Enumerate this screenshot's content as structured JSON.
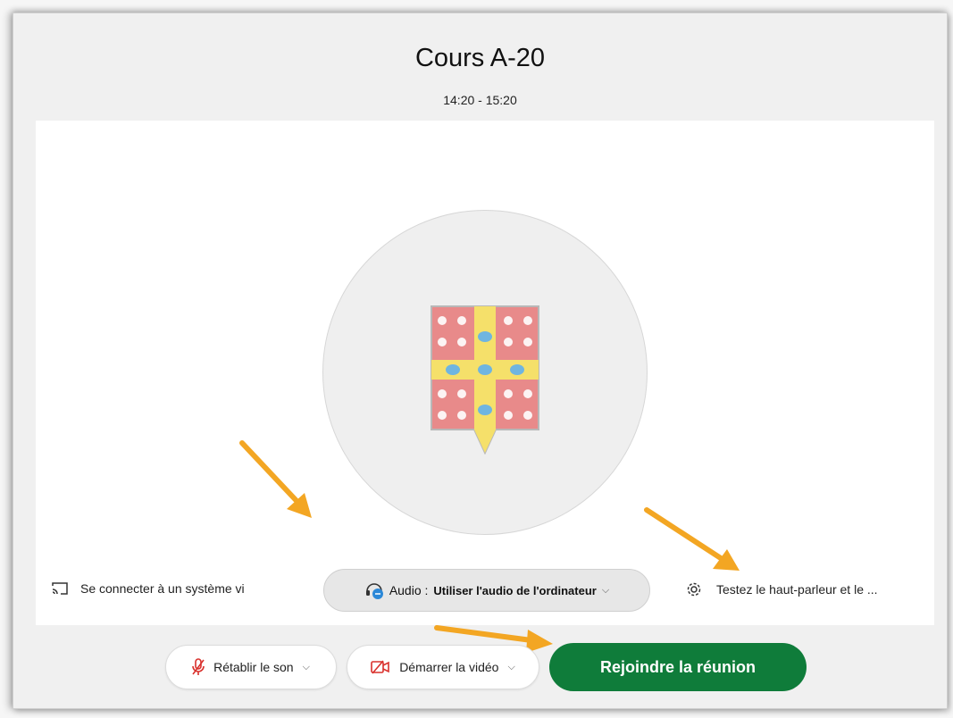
{
  "meeting": {
    "title": "Cours A-20",
    "time": "14:20 - 15:20"
  },
  "bottom_bar": {
    "connect_label": "Se connecter à un système vi",
    "audio_prefix": "Audio : ",
    "audio_value": "Utiliser l'audio de l'ordinateur",
    "test_label": "Testez le haut-parleur et le ..."
  },
  "controls": {
    "unmute_label": "Rétablir le son",
    "video_label": "Démarrer la vidéo",
    "join_label": "Rejoindre la réunion"
  },
  "icons": [
    "cast-icon",
    "headset-icon",
    "gear-icon",
    "mic-muted-icon",
    "video-off-icon",
    "chevron-down-icon",
    "crest-avatar",
    "annotation-arrow"
  ],
  "colors": {
    "join_button": "#0f7c3a",
    "arrow": "#f3a623",
    "muted_icon": "#d9302c",
    "crest_red": "#e88a8a",
    "crest_yellow": "#f5e06a",
    "crest_blue": "#6fb5e0"
  }
}
